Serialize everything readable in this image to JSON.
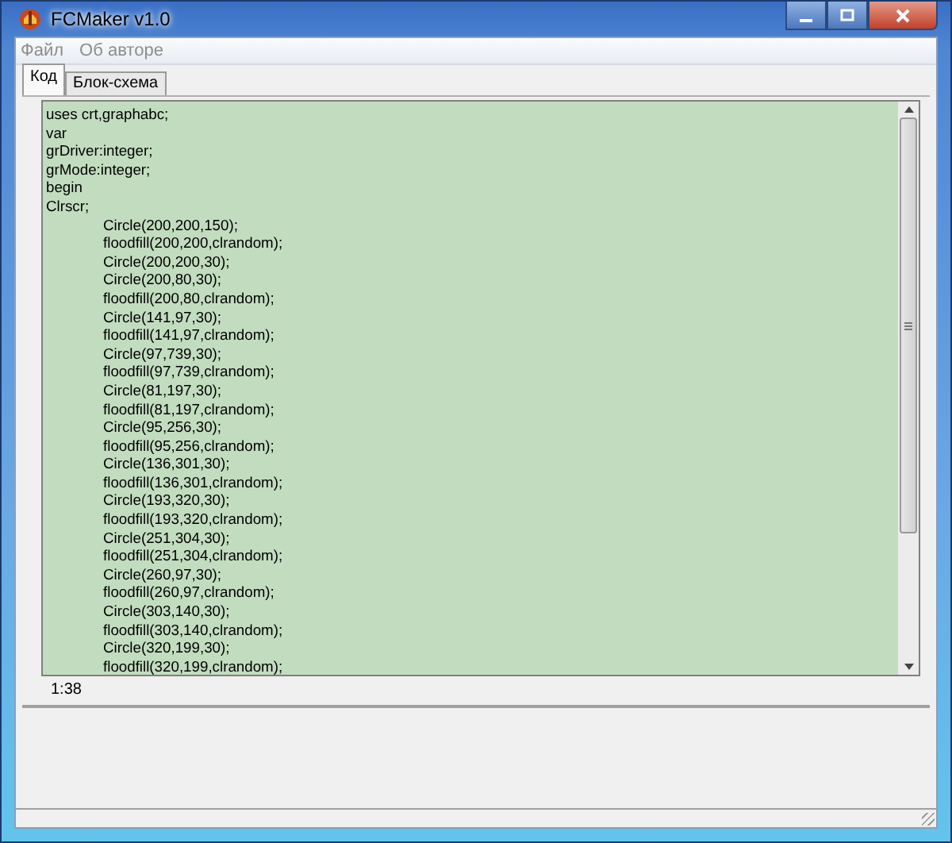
{
  "window": {
    "title": "FCMaker v1.0"
  },
  "menu": [
    {
      "label": "Файл",
      "disabled": true
    },
    {
      "label": "Об авторе",
      "disabled": true
    }
  ],
  "tabs": [
    {
      "label": "Код",
      "selected": true
    },
    {
      "label": "Блок-схема",
      "selected": false
    }
  ],
  "code": [
    {
      "text": "uses crt,graphabc;",
      "indented": false
    },
    {
      "text": "var",
      "indented": false
    },
    {
      "text": "grDriver:integer;",
      "indented": false
    },
    {
      "text": "grMode:integer;",
      "indented": false
    },
    {
      "text": "begin",
      "indented": false
    },
    {
      "text": "Clrscr;",
      "indented": false
    },
    {
      "text": "Circle(200,200,150);",
      "indented": true
    },
    {
      "text": "floodfill(200,200,clrandom);",
      "indented": true
    },
    {
      "text": "Circle(200,200,30);",
      "indented": true
    },
    {
      "text": "Circle(200,80,30);",
      "indented": true
    },
    {
      "text": "floodfill(200,80,clrandom);",
      "indented": true
    },
    {
      "text": "Circle(141,97,30);",
      "indented": true
    },
    {
      "text": "floodfill(141,97,clrandom);",
      "indented": true
    },
    {
      "text": "Circle(97,739,30);",
      "indented": true
    },
    {
      "text": "floodfill(97,739,clrandom);",
      "indented": true
    },
    {
      "text": "Circle(81,197,30);",
      "indented": true
    },
    {
      "text": "floodfill(81,197,clrandom);",
      "indented": true
    },
    {
      "text": "Circle(95,256,30);",
      "indented": true
    },
    {
      "text": "floodfill(95,256,clrandom);",
      "indented": true
    },
    {
      "text": "Circle(136,301,30);",
      "indented": true
    },
    {
      "text": "floodfill(136,301,clrandom);",
      "indented": true
    },
    {
      "text": "Circle(193,320,30);",
      "indented": true
    },
    {
      "text": "floodfill(193,320,clrandom);",
      "indented": true
    },
    {
      "text": "Circle(251,304,30);",
      "indented": true
    },
    {
      "text": "floodfill(251,304,clrandom);",
      "indented": true
    },
    {
      "text": "Circle(260,97,30);",
      "indented": true
    },
    {
      "text": "floodfill(260,97,clrandom);",
      "indented": true
    },
    {
      "text": "Circle(303,140,30);",
      "indented": true
    },
    {
      "text": "floodfill(303,140,clrandom);",
      "indented": true
    },
    {
      "text": "Circle(320,199,30);",
      "indented": true
    },
    {
      "text": "floodfill(320,199,clrandom);",
      "indented": true
    }
  ],
  "cursor_position": "1:38"
}
